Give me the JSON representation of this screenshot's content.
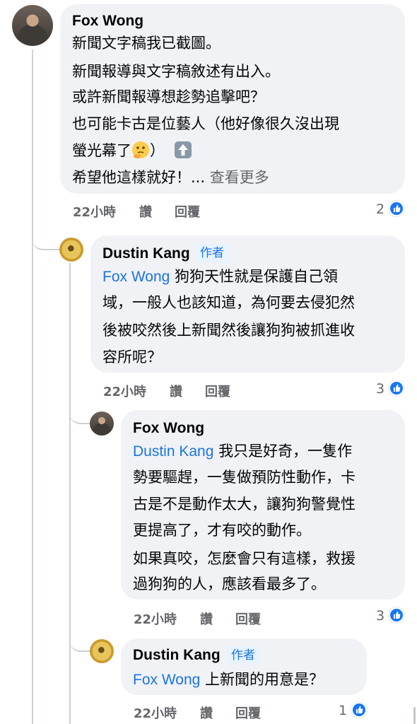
{
  "comments": [
    {
      "author": "Fox Wong",
      "lines": [
        "新聞文字稿我已截圖。",
        "新聞報導與文字稿敘述有出入。",
        "或許新聞報導想趁勢追擊吧？",
        "也可能卡古是位藝人（他好像很久沒出現",
        "螢光幕了",
        "）",
        "希望他這樣就好！... ",
        "查看更多"
      ],
      "time": "22小時",
      "like_label": "讚",
      "reply_label": "回覆",
      "reaction_count": "2",
      "emoji_icons": [
        "thinking-face-icon",
        "up-arrow-icon"
      ]
    },
    {
      "author": "Dustin Kang",
      "badge": "作者",
      "mention": "Fox Wong",
      "lines": [
        " 狗狗天性就是保護自己領",
        "域，一般人也該知道，為何要去侵犯然",
        "後被咬然後上新聞然後讓狗狗被抓進收",
        "容所呢？"
      ],
      "time": "22小時",
      "like_label": "讚",
      "reply_label": "回覆",
      "reaction_count": "3"
    },
    {
      "author": "Fox Wong",
      "mention": "Dustin Kang",
      "lines": [
        " 我只是好奇，一隻作",
        "勢要驅趕，一隻做預防性動作，卡",
        "古是不是動作太大，讓狗狗警覺性",
        "更提高了，才有咬的動作。",
        "如果真咬，怎麼會只有這樣，救援",
        "過狗狗的人，應該看最多了。"
      ],
      "time": "22小時",
      "like_label": "讚",
      "reply_label": "回覆",
      "reaction_count": "3"
    },
    {
      "author": "Dustin Kang",
      "badge": "作者",
      "mention": "Fox Wong",
      "lines": [
        " 上新聞的用意是？"
      ],
      "time": "22小時",
      "like_label": "讚",
      "reply_label": "回覆",
      "reaction_count": "1"
    }
  ],
  "colors": {
    "bubble": "#f0f2f5",
    "mention": "#1b74e4",
    "meta": "#65676b",
    "like": "#1877f2",
    "thread_line": "#ced0d4"
  }
}
